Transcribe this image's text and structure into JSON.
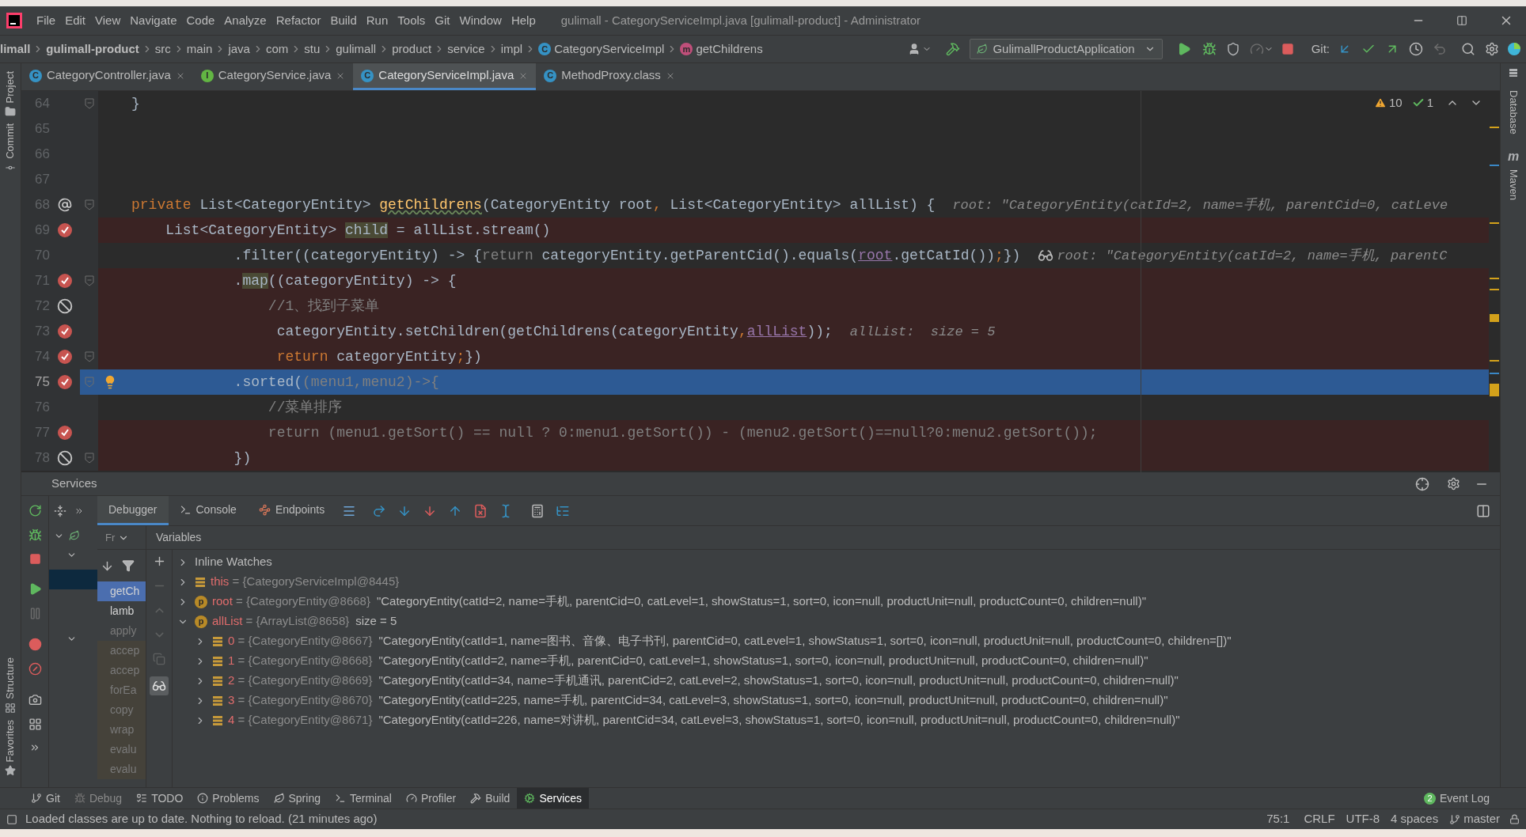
{
  "title_bar": {
    "menus": [
      "File",
      "Edit",
      "View",
      "Navigate",
      "Code",
      "Analyze",
      "Refactor",
      "Build",
      "Run",
      "Tools",
      "Git",
      "Window",
      "Help"
    ],
    "title": "gulimall - CategoryServiceImpl.java [gulimall-product] - Administrator"
  },
  "nav_bar": {
    "breadcrumbs": [
      {
        "label": "limall",
        "kind": "module"
      },
      {
        "label": "gulimall-product",
        "kind": "module"
      },
      {
        "label": "src",
        "kind": "folder"
      },
      {
        "label": "main",
        "kind": "folder"
      },
      {
        "label": "java",
        "kind": "folder"
      },
      {
        "label": "com",
        "kind": "folder"
      },
      {
        "label": "stu",
        "kind": "folder"
      },
      {
        "label": "gulimall",
        "kind": "folder"
      },
      {
        "label": "product",
        "kind": "folder"
      },
      {
        "label": "service",
        "kind": "folder"
      },
      {
        "label": "impl",
        "kind": "folder"
      },
      {
        "label": "CategoryServiceImpl",
        "kind": "class",
        "letter": "C"
      },
      {
        "label": "getChildrens",
        "kind": "method",
        "letter": "m"
      }
    ],
    "run_config": "GulimallProductApplication",
    "git_label": "Git:"
  },
  "editor_tabs": [
    {
      "label": "CategoryController.java",
      "letter": "C",
      "kind": "class",
      "selected": false
    },
    {
      "label": "CategoryService.java",
      "letter": "I",
      "kind": "interface",
      "selected": false
    },
    {
      "label": "CategoryServiceImpl.java",
      "letter": "C",
      "kind": "class",
      "selected": true
    },
    {
      "label": "MethodProxy.class",
      "letter": "C",
      "kind": "compiled",
      "selected": false
    }
  ],
  "editor": {
    "warnings": "10",
    "checks": "1",
    "lines": [
      {
        "number": "64",
        "kind": "plain",
        "fold": true,
        "current": false,
        "bulb": false,
        "tokens": [
          {
            "text": "}",
            "kind": "plain"
          }
        ]
      },
      {
        "number": "65",
        "kind": "plain",
        "current": false
      },
      {
        "number": "66",
        "kind": "plain",
        "current": false
      },
      {
        "number": "67",
        "kind": "plain",
        "current": false
      },
      {
        "number": "68",
        "kind": "annotation",
        "fold": true,
        "current": false,
        "bulb": false,
        "tokens": [
          {
            "text": "private",
            "kind": "keyword"
          },
          {
            "text": " List<CategoryEntity> ",
            "kind": "plain"
          },
          {
            "text": "getChildrens",
            "kind": "method"
          },
          {
            "text": "(CategoryEntity root",
            "kind": "plain"
          },
          {
            "text": ",",
            "kind": "keyword"
          },
          {
            "text": " List<CategoryEntity> allList) {",
            "kind": "plain"
          }
        ],
        "hint": {
          "text": "root: \"CategoryEntity(catId=2, name=手机, parentCid=0, catLeve"
        }
      },
      {
        "number": "69",
        "kind": "breakpoint",
        "fold": false,
        "current": false,
        "bulb": false,
        "tokens": [
          {
            "text": "    List<CategoryEntity> ",
            "kind": "plain"
          },
          {
            "text": "child",
            "kind": "highlight"
          },
          {
            "text": " = allList.stream()",
            "kind": "plain"
          }
        ]
      },
      {
        "number": "70",
        "kind": "plain",
        "fold": false,
        "current": false,
        "bulb": false,
        "tokens": [
          {
            "text": "            .filter((categoryEntity) -> {",
            "kind": "plain"
          },
          {
            "text": "return",
            "kind": "dim"
          },
          {
            "text": " categoryEntity.getParentCid().equals(",
            "kind": "plain"
          },
          {
            "text": "root",
            "kind": "link"
          },
          {
            "text": ".getCatId())",
            "kind": "plain"
          },
          {
            "text": ";",
            "kind": "keyword"
          },
          {
            "text": "})",
            "kind": "plain"
          }
        ],
        "hint": {
          "text": "root: \"CategoryEntity(catId=2, name=手机, parentC",
          "watch": true
        }
      },
      {
        "number": "71",
        "kind": "breakpoint",
        "fold": true,
        "current": false,
        "bulb": false,
        "tokens": [
          {
            "text": "            .",
            "kind": "plain"
          },
          {
            "text": "map",
            "kind": "highlight"
          },
          {
            "text": "((categoryEntity) -> {",
            "kind": "plain"
          }
        ]
      },
      {
        "number": "72",
        "kind": "disabled",
        "fold": false,
        "current": false,
        "bulb": false,
        "tokens": [
          {
            "text": "                //1、找到子菜单",
            "kind": "comment"
          }
        ]
      },
      {
        "number": "73",
        "kind": "breakpoint",
        "fold": false,
        "current": false,
        "bulb": false,
        "tokens": [
          {
            "text": "                 categoryEntity.setChildren(getChildrens(categoryEntity",
            "kind": "plain"
          },
          {
            "text": ",",
            "kind": "keyword"
          },
          {
            "text": "allList",
            "kind": "link"
          },
          {
            "text": "));",
            "kind": "plain"
          }
        ],
        "hint": {
          "text": "allList:  size = 5"
        }
      },
      {
        "number": "74",
        "kind": "breakpoint",
        "fold": true,
        "current": false,
        "bulb": false,
        "tokens": [
          {
            "text": "                 return",
            "kind": "keyword"
          },
          {
            "text": " categoryEntity",
            "kind": "plain"
          },
          {
            "text": ";",
            "kind": "keyword"
          },
          {
            "text": "})",
            "kind": "plain"
          }
        ]
      },
      {
        "number": "75",
        "kind": "breakpoint",
        "fold": true,
        "current": true,
        "bulb": true,
        "tokens": [
          {
            "text": "            .sorted(",
            "kind": "plain"
          },
          {
            "text": "(menu1,menu2)->{",
            "kind": "dim"
          }
        ]
      },
      {
        "number": "76",
        "kind": "plain",
        "fold": false,
        "current": false,
        "bulb": false,
        "tokens": [
          {
            "text": "                //菜单排序",
            "kind": "comment"
          }
        ]
      },
      {
        "number": "77",
        "kind": "breakpoint",
        "fold": false,
        "current": false,
        "bulb": false,
        "tokens": [
          {
            "text": "                return (menu1.getSort() == null ? 0:menu1.getSort()) - (menu2.getSort()==null?0:menu2.getSort());",
            "kind": "dim"
          }
        ]
      },
      {
        "number": "78",
        "kind": "disabled",
        "fold": true,
        "current": false,
        "bulb": false,
        "tokens": [
          {
            "text": "            })",
            "kind": "plain"
          }
        ]
      }
    ]
  },
  "left_stripe": [
    {
      "label": "Project",
      "kind": "folder"
    },
    {
      "label": "Commit",
      "kind": "commit"
    },
    {
      "label": "Structure",
      "kind": "structure"
    },
    {
      "label": "Favorites",
      "kind": "star"
    }
  ],
  "right_stripe": [
    {
      "label": "Database"
    },
    {
      "label": "Maven",
      "letter": "m"
    }
  ],
  "services": {
    "title": "Services",
    "debugger_tabs": [
      {
        "label": "Debugger",
        "kind": "debugger",
        "selected": true
      },
      {
        "label": "Console",
        "kind": "console",
        "selected": false
      },
      {
        "label": "Endpoints",
        "kind": "endpoints",
        "selected": false
      }
    ],
    "frames_selector": "Fr",
    "frames": [
      {
        "label": "getCh",
        "kind": "user",
        "selected": true
      },
      {
        "label": "lamb",
        "kind": "user",
        "selected": false
      },
      {
        "label": "apply",
        "kind": "faded",
        "selected": false
      },
      {
        "label": "accep",
        "kind": "library",
        "selected": false
      },
      {
        "label": "accep",
        "kind": "library",
        "selected": false
      },
      {
        "label": "forEa",
        "kind": "library",
        "selected": false
      },
      {
        "label": "copy",
        "kind": "library",
        "selected": false
      },
      {
        "label": "wrap",
        "kind": "library",
        "selected": false
      },
      {
        "label": "evalu",
        "kind": "library",
        "selected": false
      },
      {
        "label": "evalu",
        "kind": "library",
        "selected": false
      }
    ],
    "variables_title": "Variables",
    "variables": [
      {
        "kind": "group",
        "name": "Inline Watches",
        "expanded": false
      },
      {
        "kind": "field",
        "name": "this",
        "ref": "= {CategoryServiceImpl@8445}",
        "expanded": false
      },
      {
        "kind": "param",
        "letter": "p",
        "name": "root",
        "ref": "= {CategoryEntity@8668}",
        "value": "\"CategoryEntity(catId=2, name=手机, parentCid=0, catLevel=1, showStatus=1, sort=0, icon=null, productUnit=null, productCount=0, children=null)\"",
        "expanded": false
      },
      {
        "kind": "param",
        "letter": "p",
        "name": "allList",
        "ref": "= {ArrayList@8658}",
        "value": "size = 5",
        "expanded": true,
        "children": [
          {
            "kind": "field",
            "name": "0",
            "ref": "= {CategoryEntity@8667}",
            "value": "\"CategoryEntity(catId=1, name=图书、音像、电子书刊, parentCid=0, catLevel=1, showStatus=1, sort=0, icon=null, productUnit=null, productCount=0, children=[])\"",
            "expanded": false
          },
          {
            "kind": "field",
            "name": "1",
            "ref": "= {CategoryEntity@8668}",
            "value": "\"CategoryEntity(catId=2, name=手机, parentCid=0, catLevel=1, showStatus=1, sort=0, icon=null, productUnit=null, productCount=0, children=null)\"",
            "expanded": false
          },
          {
            "kind": "field",
            "name": "2",
            "ref": "= {CategoryEntity@8669}",
            "value": "\"CategoryEntity(catId=34, name=手机通讯, parentCid=2, catLevel=2, showStatus=1, sort=0, icon=null, productUnit=null, productCount=0, children=null)\"",
            "expanded": false
          },
          {
            "kind": "field",
            "name": "3",
            "ref": "= {CategoryEntity@8670}",
            "value": "\"CategoryEntity(catId=225, name=手机, parentCid=34, catLevel=3, showStatus=1, sort=0, icon=null, productUnit=null, productCount=0, children=null)\"",
            "expanded": false
          },
          {
            "kind": "field",
            "name": "4",
            "ref": "= {CategoryEntity@8671}",
            "value": "\"CategoryEntity(catId=226, name=对讲机, parentCid=34, catLevel=3, showStatus=1, sort=0, icon=null, productUnit=null, productCount=0, children=null)\"",
            "expanded": false
          }
        ]
      }
    ]
  },
  "tool_tabs": [
    {
      "label": "Git",
      "kind": "git",
      "selected": false
    },
    {
      "label": "Debug",
      "kind": "debug",
      "selected": false
    },
    {
      "label": "TODO",
      "kind": "todo",
      "selected": false
    },
    {
      "label": "Problems",
      "kind": "problems",
      "selected": false
    },
    {
      "label": "Spring",
      "kind": "spring",
      "selected": false
    },
    {
      "label": "Terminal",
      "kind": "terminal",
      "selected": false
    },
    {
      "label": "Profiler",
      "kind": "profiler",
      "selected": false
    },
    {
      "label": "Build",
      "kind": "build",
      "selected": false
    },
    {
      "label": "Services",
      "kind": "services",
      "selected": true
    }
  ],
  "event_log": {
    "count": "2",
    "label": "Event Log"
  },
  "status_bar": {
    "message": "Loaded classes are up to date. Nothing to reload. (21 minutes ago)",
    "position": "75:1",
    "line_separator": "CRLF",
    "encoding": "UTF-8",
    "indent": "4 spaces",
    "branch": "master"
  }
}
